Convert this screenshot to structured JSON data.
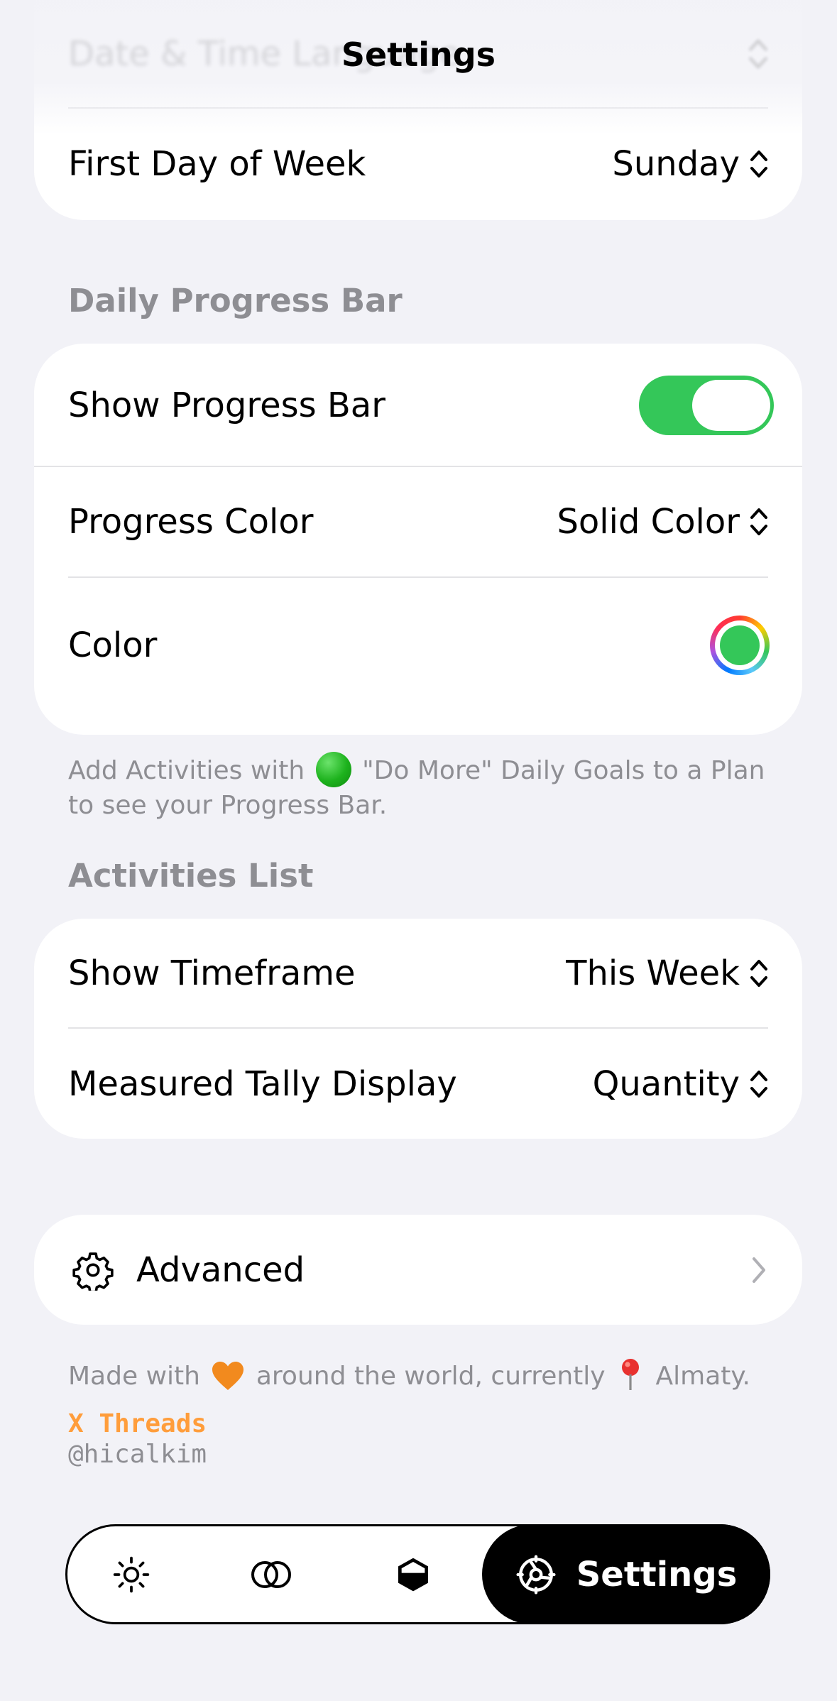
{
  "header": {
    "title": "Settings",
    "faded_row_label": "Date & Time Language"
  },
  "calendar_section": {
    "first_day_label": "First Day of Week",
    "first_day_value": "Sunday"
  },
  "progress_section": {
    "header": "Daily Progress Bar",
    "show_progress_label": "Show Progress Bar",
    "show_progress_on": true,
    "progress_color_label": "Progress Color",
    "progress_color_value": "Solid Color",
    "color_label": "Color",
    "selected_color": "#34c759",
    "footnote_before": "Add Activities with",
    "footnote_after": "\"Do More\" Daily Goals to a Plan to see your Progress Bar."
  },
  "activities_section": {
    "header": "Activities List",
    "timeframe_label": "Show Timeframe",
    "timeframe_value": "This Week",
    "tally_label": "Measured Tally Display",
    "tally_value": "Quantity"
  },
  "advanced": {
    "label": "Advanced",
    "icon": "gear-icon"
  },
  "credits": {
    "made_with_1": "Made with",
    "made_with_2": "around the world, currently",
    "location": "Almaty.",
    "links": "X Threads",
    "handle": "@hicalkim"
  },
  "tabbar": {
    "tabs": [
      {
        "icon": "sun-icon"
      },
      {
        "icon": "two-circles-icon"
      },
      {
        "icon": "half-filled-hexagon-icon"
      },
      {
        "icon": "gear-icon",
        "label": "Settings",
        "active": true
      }
    ]
  },
  "colors": {
    "accent_green": "#34c759",
    "link_orange": "#ff9d3b",
    "secondary_text": "#8e8e93",
    "background": "#f2f2f7"
  }
}
